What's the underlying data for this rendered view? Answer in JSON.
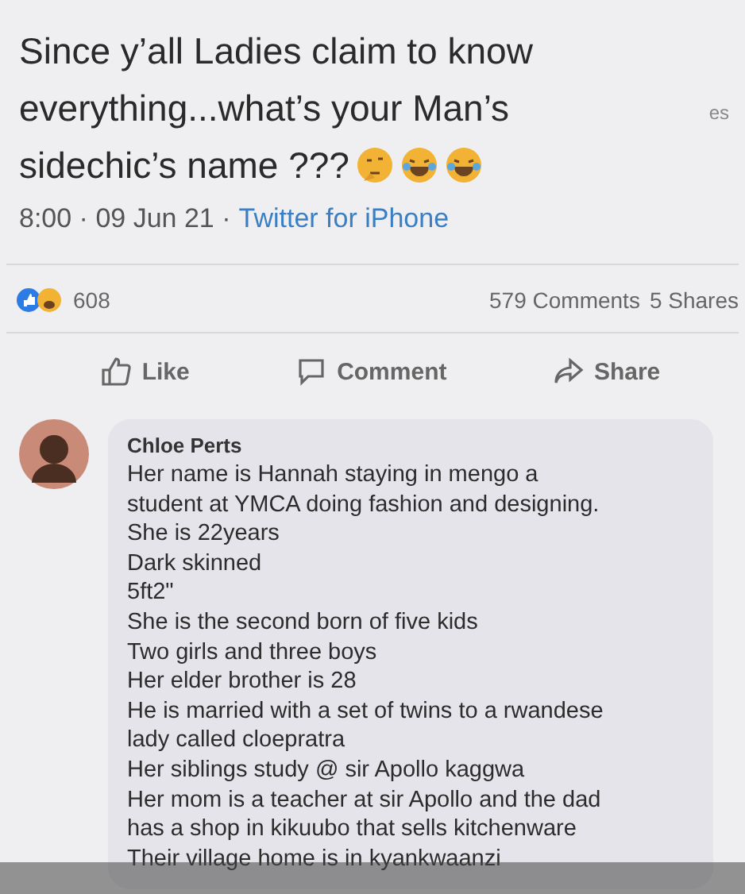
{
  "post": {
    "lines": [
      "Since y’all Ladies claim to know",
      "everything...what’s your Man’s",
      "sidechic’s name ???"
    ],
    "side_text": "es",
    "time": "8:00 · 09 Jun 21 ·",
    "source": "Twitter for iPhone"
  },
  "stats": {
    "reactions": "608",
    "comments": "579 Comments",
    "shares": "5 Shares"
  },
  "actions": [
    {
      "kind": "like",
      "label": "Like"
    },
    {
      "kind": "comment",
      "label": "Comment"
    },
    {
      "kind": "share",
      "label": "Share"
    }
  ],
  "comment": {
    "author": "Chloe Perts",
    "lines": [
      "Her name is Hannah staying in mengo a",
      "student at YMCA doing fashion and designing.",
      "She is 22years",
      "Dark skinned",
      "5ft2\"",
      "She is the second born of five kids",
      "Two girls and three boys",
      "Her elder brother is 28",
      "He is married with a set of twins to a rwandese",
      "lady called cloepratra",
      "Her siblings study @ sir Apollo kaggwa",
      "Her mom is a teacher at sir Apollo and the dad",
      "has a shop in kikuubo that sells kitchenware",
      "Their village home is in kyankwaanzi"
    ]
  }
}
